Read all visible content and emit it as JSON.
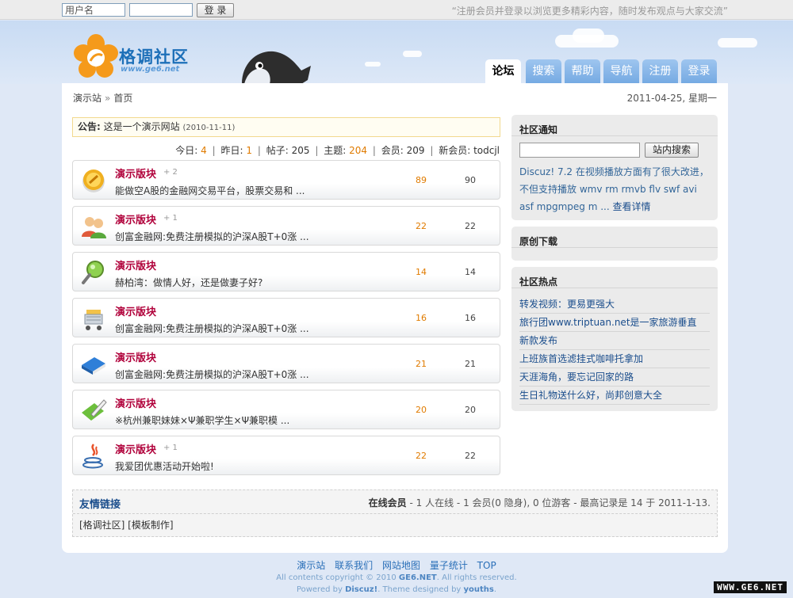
{
  "topbar": {
    "username_value": "用户名",
    "password_value": "",
    "login_button": "登 录",
    "slogan": "“注册会员并登录以浏览更多精彩内容，随时发布观点与大家交流”"
  },
  "header": {
    "logo_title": "格调社区",
    "logo_url": "www.ge6.net",
    "nav": [
      {
        "label": "论坛",
        "active": true
      },
      {
        "label": "搜索"
      },
      {
        "label": "帮助"
      },
      {
        "label": "导航"
      },
      {
        "label": "注册"
      },
      {
        "label": "登录"
      }
    ]
  },
  "breadcrumb": {
    "site": "演示站",
    "sep": "»",
    "page": "首页"
  },
  "date": "2011-04-25, 星期一",
  "announcement": {
    "label": "公告:",
    "text": "这是一个演示网站",
    "date": "(2010-11-11)"
  },
  "stats": {
    "today_label": "今日:",
    "today": "4",
    "yesterday_label": "昨日:",
    "yesterday": "1",
    "posts_label": "帖子:",
    "posts": "205",
    "topics_label": "主题:",
    "topics": "204",
    "members_label": "会员:",
    "members": "209",
    "newest_label": "新会员:",
    "newest": "todcjl",
    "sep": "|"
  },
  "forums": [
    {
      "name": "演示版块",
      "new": "+ 2",
      "last": "能做空A股的金融网交易平台，股票交易和 ...",
      "topics": "89",
      "posts": "90",
      "icon": "gold-coin-icon"
    },
    {
      "name": "演示版块",
      "new": "+ 1",
      "last": "创富金融网:免费注册模拟的沪深A股T+0涨 ...",
      "topics": "22",
      "posts": "22",
      "icon": "users-icon"
    },
    {
      "name": "演示版块",
      "new": "",
      "last": "赫柏湾：做情人好，还是做妻子好?",
      "topics": "14",
      "posts": "14",
      "icon": "magnifier-icon"
    },
    {
      "name": "演示版块",
      "new": "",
      "last": "创富金融网:免费注册模拟的沪深A股T+0涨 ...",
      "topics": "16",
      "posts": "16",
      "icon": "shopping-cart-icon"
    },
    {
      "name": "演示版块",
      "new": "",
      "last": "创富金融网:免费注册模拟的沪深A股T+0涨 ...",
      "topics": "21",
      "posts": "21",
      "icon": "book-icon"
    },
    {
      "name": "演示版块",
      "new": "",
      "last": "※杭州兼职妹妹×Ψ兼职学生×Ψ兼职模 ...",
      "topics": "20",
      "posts": "20",
      "icon": "edit-icon"
    },
    {
      "name": "演示版块",
      "new": "+ 1",
      "last": "我爱团优惠活动开始啦!",
      "topics": "22",
      "posts": "22",
      "icon": "java-icon"
    }
  ],
  "sidebar": {
    "notice_title": "社区通知",
    "search_value": "",
    "search_button": "站内搜索",
    "notice_text": "Discuz! 7.2 在视频播放方面有了很大改进，不但支持播放 wmv rm rmvb flv swf avi asf mpgmpeg m ...",
    "notice_more": "查看详情",
    "download_title": "原创下载",
    "hot_title": "社区热点",
    "hot_items": [
      "转发视频：更易更强大",
      "旅行团www.triptuan.net是一家旅游垂直",
      "新款发布",
      "上班族首选滤挂式咖啡托拿加",
      "天涯海角，要忘记回家的路",
      "生日礼物送什么好，尚邦创意大全"
    ]
  },
  "links": {
    "title": "友情链接",
    "online_label": "在线会员",
    "online_text": "- 1 人在线 - 1 会员(0 隐身), 0 位游客 - 最高记录是 14 于 2011-1-13.",
    "friend_links": "[格调社区] [模板制作]"
  },
  "footer": {
    "nav": [
      "演示站",
      "联系我们",
      "网站地图",
      "量子统计",
      "TOP"
    ],
    "copy1_pre": "All contents copyright © 2010 ",
    "copy1_brand": "GE6.NET",
    "copy1_post": ". All rights reserved.",
    "copy2_pre": "Powered by ",
    "copy2_brand": "Discuz!",
    "copy2_mid": ". Theme designed by ",
    "copy2_author": "youths",
    "copy2_post": ".",
    "badge": "WWW.GE6.NET"
  },
  "colors": {
    "accent": "#1c6fb8",
    "forum_name": "#b0003a",
    "highlight": "#e07b00"
  }
}
